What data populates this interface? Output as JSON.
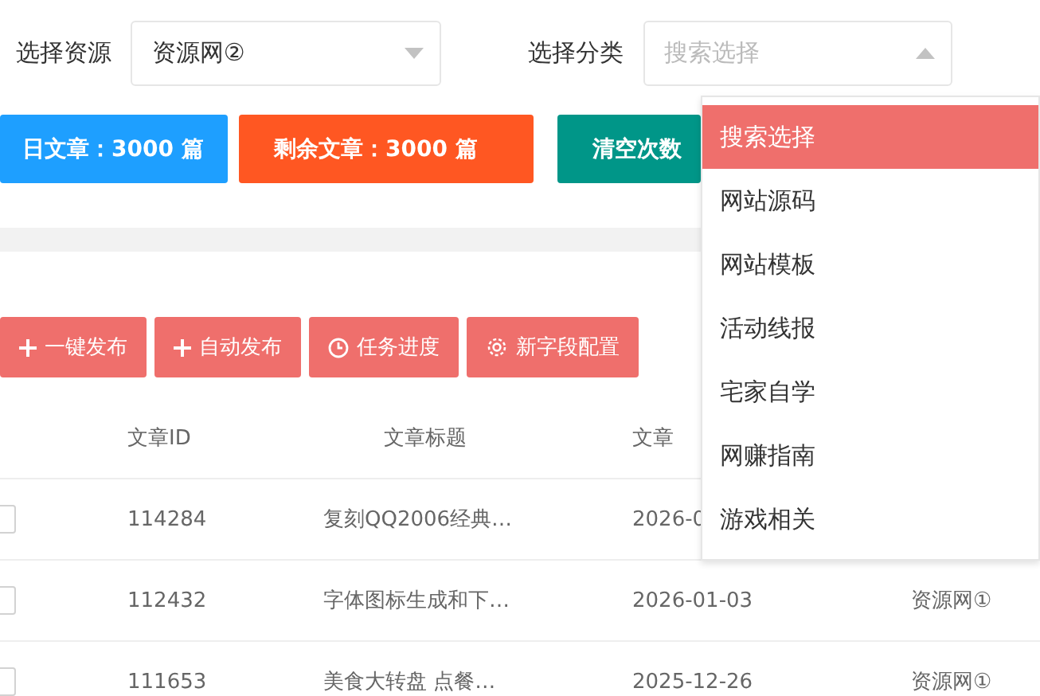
{
  "filters": [
    {
      "label": "选择资源",
      "value": "资源网②",
      "expanded": false
    },
    {
      "label": "选择分类",
      "placeholder": "搜索选择",
      "expanded": true
    }
  ],
  "stats": [
    {
      "text": "日文章：3000 篇",
      "color": "#1e9fff"
    },
    {
      "text": "剩余文章：3000 篇",
      "color": "#ff5722"
    },
    {
      "text": "清空次数",
      "color": "#009688"
    }
  ],
  "actions": [
    {
      "kind": "plus",
      "label": "一键发布"
    },
    {
      "kind": "plus",
      "label": "自动发布"
    },
    {
      "kind": "clock",
      "label": "任务进度"
    },
    {
      "kind": "gear",
      "label": "新字段配置"
    }
  ],
  "table": {
    "columns": [
      "文章ID",
      "文章标题",
      "文章"
    ],
    "rows": [
      {
        "checked": false,
        "cells": [
          "114284",
          "复刻QQ2006经典…",
          "2026-0",
          ""
        ]
      },
      {
        "checked": false,
        "cells": [
          "112432",
          "字体图标生成和下…",
          "2026-01-03",
          "资源网①"
        ]
      },
      {
        "checked": false,
        "cells": [
          "111653",
          "美食大转盘 点餐…",
          "2025-12-26",
          "资源网①"
        ]
      }
    ]
  },
  "dropdown": [
    {
      "label": "搜索选择",
      "selected": true
    },
    {
      "label": "网站源码",
      "selected": false
    },
    {
      "label": "网站模板",
      "selected": false
    },
    {
      "label": "活动线报",
      "selected": false
    },
    {
      "label": "宅家自学",
      "selected": false
    },
    {
      "label": "网赚指南",
      "selected": false
    },
    {
      "label": "游戏相关",
      "selected": false
    }
  ]
}
